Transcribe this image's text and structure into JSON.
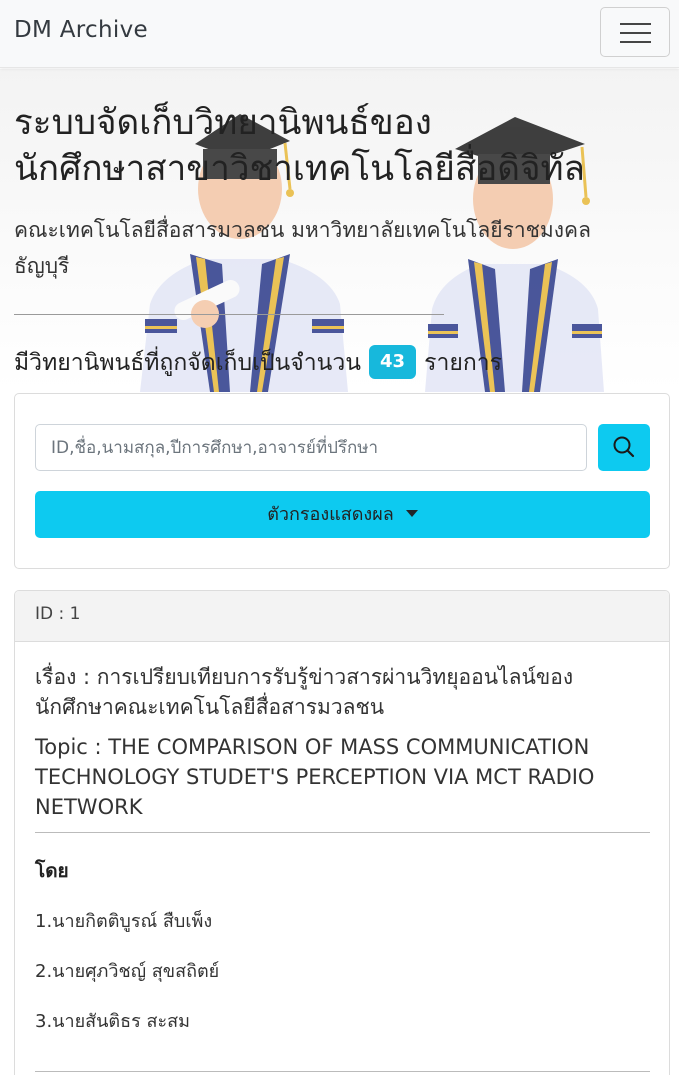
{
  "navbar": {
    "brand": "DM Archive",
    "toggle_icon": "hamburger-menu-icon"
  },
  "hero": {
    "title_line1": "ระบบจัดเก็บวิทยานิพนธ์ของ",
    "title_line2": "นักศึกษาสาขาวิชาเทคโนโลยีสื่อดิจิทัล",
    "subtitle_line1": "คณะเทคโนโลยีสื่อสารมวลชน มหาวิทยาลัยเทคโนโลยีราชมงคล",
    "subtitle_line2": "ธัญบุรี",
    "count_prefix": "มีวิทยานิพนธ์ที่ถูกจัดเก็บเป็นจำนวน",
    "count_value": "43",
    "count_suffix": "รายการ",
    "illustration": "graduates-illustration"
  },
  "search": {
    "placeholder": "ID,ชื่อ,นามสกุล,ปีการศึกษา,อาจารย์ที่ปรึกษา",
    "button_icon": "search-icon",
    "filter_label": "ตัวกรองแสดงผล",
    "filter_icon": "caret-down-icon"
  },
  "thesis": {
    "id_label": "ID : 1",
    "title_line1": "เรื่อง : การเปรียบเทียบการรับรู้ข่าวสารผ่านวิทยุออนไลน์ของ",
    "title_line2": "นักศึกษาคณะเทคโนโลยีสื่อสารมวลชน",
    "topic_line1": "Topic : THE COMPARISON OF MASS COMMUNICATION",
    "topic_line2": "TECHNOLOGY STUDET'S PERCEPTION VIA MCT RADIO",
    "topic_line3": "NETWORK",
    "by_label": "โดย",
    "authors": [
      "1.นายกิตติบูรณ์ สืบเพ็ง",
      "2.นายศุภวิชญ์ สุขสถิตย์",
      "3.นายสันติธร สะสม"
    ]
  },
  "colors": {
    "accent": "#0dcaf0",
    "badge": "#17b8dc",
    "navbar_bg": "#f8f9fa"
  }
}
